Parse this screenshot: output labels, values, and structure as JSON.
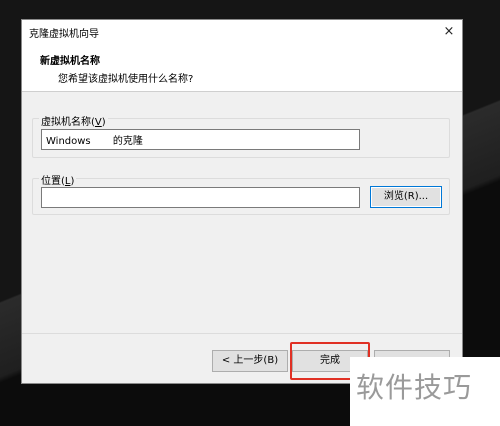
{
  "window": {
    "title": "克隆虚拟机向导",
    "close_icon": "×"
  },
  "header": {
    "title": "新虚拟机名称",
    "subtitle": "您希望该虚拟机使用什么名称?"
  },
  "name_group": {
    "label": "虚拟机名称(",
    "mnemonic": "V",
    "label_end": ")",
    "value": "Windows       的克隆"
  },
  "location_group": {
    "label": "位置(",
    "mnemonic": "L",
    "label_end": ")",
    "value": "",
    "browse_label": "浏览(R)..."
  },
  "buttons": {
    "back_label": "< 上一步(B)",
    "finish_label": "完成",
    "cancel_label": ""
  },
  "watermark": "软件技巧",
  "colors": {
    "highlight": "#e03024",
    "focus_border": "#0078d7"
  }
}
